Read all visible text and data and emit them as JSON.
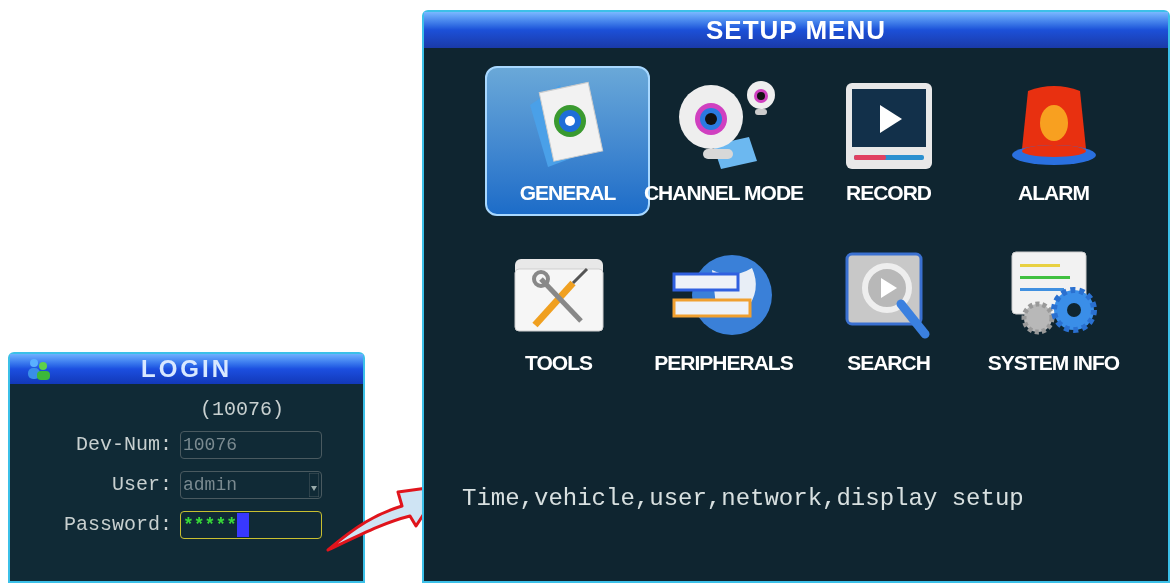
{
  "login": {
    "title": "LOGIN",
    "device_id": "(10076)",
    "fields": [
      {
        "kind": "text",
        "label": "Dev-Num:",
        "value": "10076",
        "focused": false
      },
      {
        "kind": "dropdown",
        "label": "User:",
        "value": "admin",
        "focused": false
      },
      {
        "kind": "password",
        "label": "Password:",
        "value": "*****",
        "focused": true
      }
    ]
  },
  "setup_menu": {
    "title": "SETUP MENU",
    "items": [
      {
        "label": "GENERAL",
        "selected": true
      },
      {
        "label": "CHANNEL MODE",
        "selected": false
      },
      {
        "label": "RECORD",
        "selected": false
      },
      {
        "label": "ALARM",
        "selected": false
      },
      {
        "label": "TOOLS",
        "selected": false
      },
      {
        "label": "PERIPHERALS",
        "selected": false
      },
      {
        "label": "SEARCH",
        "selected": false
      },
      {
        "label": "SYSTEM INFO",
        "selected": false
      }
    ],
    "description": "Time,vehicle,user,network,display setup"
  }
}
